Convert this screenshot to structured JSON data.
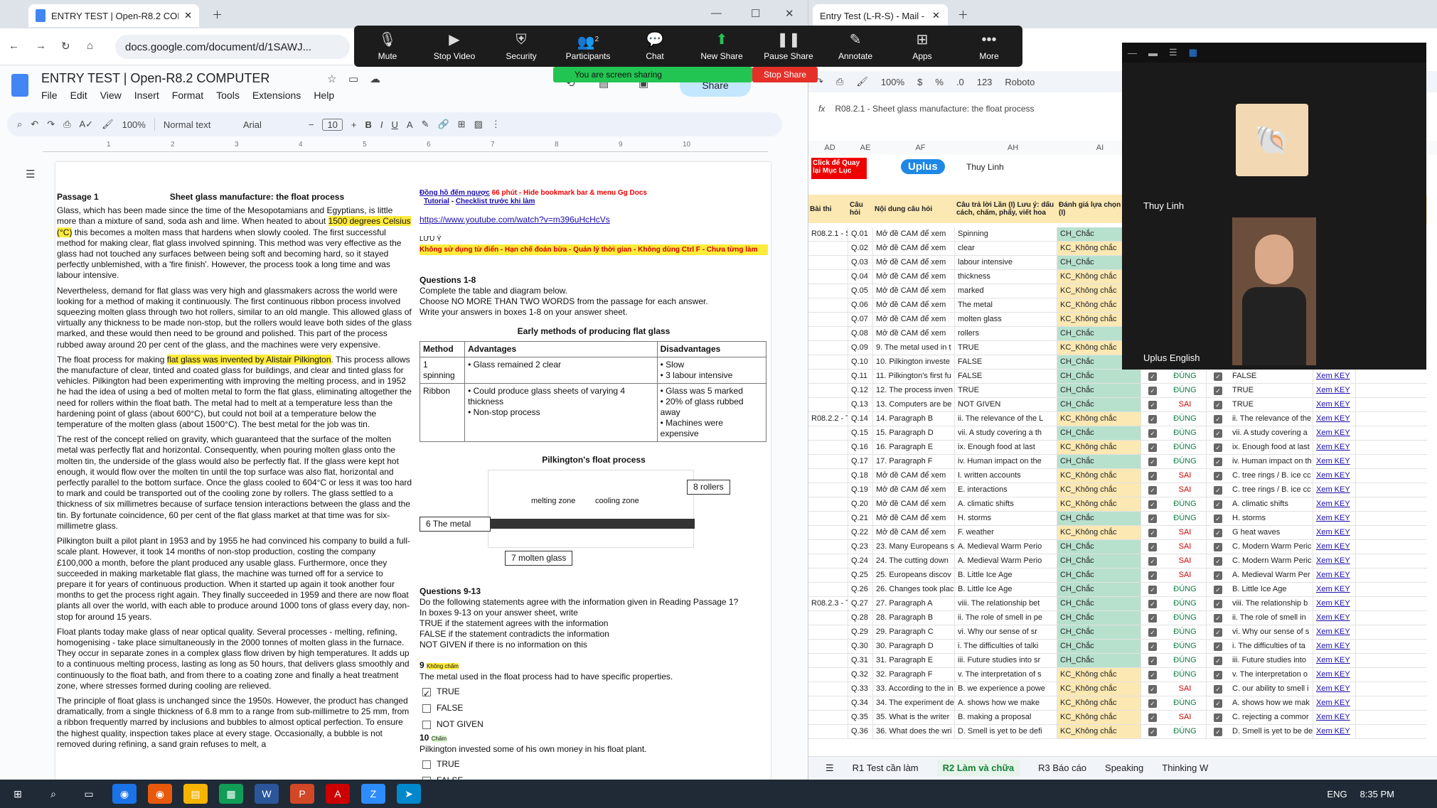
{
  "browser_left": {
    "tab_title": "ENTRY TEST | Open-R8.2 COMP",
    "url": "docs.google.com/document/d/1SAWJ..."
  },
  "browser_right": {
    "tab_title": "Entry Test (L-R-S) - Mail - P"
  },
  "zoom": {
    "buttons": [
      "Mute",
      "Stop Video",
      "Security",
      "Participants",
      "Chat",
      "New Share",
      "Pause Share",
      "Annotate",
      "Apps",
      "More"
    ],
    "participants_count": "2",
    "sharing_text": "You are screen sharing",
    "stop_share": "Stop Share",
    "participant1": "Thuy Linh",
    "participant2": "Uplus English"
  },
  "doc": {
    "title": "ENTRY TEST | Open-R8.2 COMPUTER",
    "menu": [
      "File",
      "Edit",
      "View",
      "Insert",
      "Format",
      "Tools",
      "Extensions",
      "Help"
    ],
    "share_label": "Share",
    "zoom": "100%",
    "style": "Normal text",
    "font": "Arial",
    "size": "10",
    "passage_label": "Passage 1",
    "passage_title": "Sheet glass manufacture: the float process",
    "p1a": "Glass, which has been made since the time of the Mesopotamians and Egyptians, is little more than a mixture of sand, soda ash and lime. When heated to about ",
    "p1hl": "1500 degrees Celsius (°C)",
    "p1b": " this becomes a molten mass that hardens when slowly cooled. The first successful method for making clear, flat glass involved spinning. This method was very effective as the glass had not touched any surfaces between being soft and becoming hard, so it stayed perfectly unblemished, with a 'fire finish'. However, the process took a long time and was labour intensive.",
    "p2": "Nevertheless, demand for flat glass was very high and glassmakers across the world were looking for a method of making it continuously. The first continuous ribbon process involved squeezing molten glass through two hot rollers, similar to an old mangle. This allowed glass of virtually any thickness to be made non-stop, but the rollers would leave both sides of the glass marked, and these would then need to be ground and polished. This part of the process rubbed away around 20 per cent of the glass, and the machines were very expensive.",
    "p3a": "The float process for making ",
    "p3hl": "flat glass was invented by Alistair Pilkington",
    "p3b": ". This process allows the manufacture of clear, tinted and coated glass for buildings, and clear and tinted glass for vehicles. Pilkington had been experimenting with improving the melting process, and in 1952 he had the idea of using a bed of molten metal to form the flat glass, eliminating altogether the need for rollers within the float bath. The metal had to melt at a temperature less than the hardening point of glass (about 600°C), but could not boil at a temperature below the temperature of the molten glass (about 1500°C). The best metal for the job was tin.",
    "p4": "The rest of the concept relied on gravity, which guaranteed that the surface of the molten metal was perfectly flat and horizontal. Consequently, when pouring molten glass onto the molten tin, the underside of the glass would also be perfectly flat. If the glass were kept hot enough, it would flow over the molten tin until the top surface was also flat, horizontal and perfectly parallel to the bottom surface. Once the glass cooled to 604°C or less it was too hard to mark and could be transported out of the cooling zone by rollers. The glass settled to a thickness of six millimetres because of surface tension interactions between the glass and the tin. By fortunate coincidence, 60 per cent of the flat glass market at that time was for six-millimetre glass.",
    "p5": "Pilkington built a pilot plant in 1953 and by 1955 he had convinced his company to build a full-scale plant. However, it took 14 months of non-stop production, costing the company £100,000 a month, before the plant produced any usable glass. Furthermore, once they succeeded in making marketable flat glass, the machine was turned off for a service to prepare it for years of continuous production. When it started up again it took another four months to get the process right again. They finally succeeded in 1959 and there are now float plants all over the world, with each able to produce around 1000 tons of glass every day, non-stop for around 15 years.",
    "p6": "Float plants today make glass of near optical quality. Several processes - melting, refining, homogenising - take place simultaneously in the 2000 tonnes of molten glass in the furnace. They occur in separate zones in a complex glass flow driven by high temperatures. It adds up to a continuous melting process, lasting as long as 50 hours, that delivers glass smoothly and continuously to the float bath, and from there to a coating zone and finally a heat treatment zone, where stresses formed during cooling are relieved.",
    "p7": "The principle of float glass is unchanged since the 1950s. However, the product has changed dramatically, from a single thickness of 6.8 mm to a range from sub-millimetre to 25 mm, from a ribbon frequently marred by inclusions and bubbles to almost optical perfection. To ensure the highest quality, inspection takes place at every stage. Occasionally, a bubble is not removed during refining, a sand grain refuses to melt, a",
    "r_timer": "Đồng hồ đếm ngược",
    "r_timer2": " 66 phút - Hide bookmark bar & menu Gg Docs",
    "r_tut": "Tutorial",
    "r_check": "Checklist trước khi làm",
    "r_link": "https://www.youtube.com/watch?v=m396uHcHcVs",
    "r_luuy": "LƯU Ý",
    "r_warn": "Không sử dụng từ điển - Hạn chế đoán bừa - Quản lý thời gian - Không dùng Ctrl F - Chưa từng làm",
    "q18": "Questions 1-8",
    "q18a": "Complete the table and diagram below.",
    "q18b": "Choose NO MORE THAN TWO WORDS from the passage for each answer.",
    "q18c": "Write your answers in boxes 1-8 on your answer sheet.",
    "tbl_title": "Early methods of producing flat glass",
    "th": [
      "Method",
      "Advantages",
      "Disadvantages"
    ],
    "r1": [
      "1  spinning",
      "• Glass remained 2  clear",
      "• Slow\n• 3  labour intensive"
    ],
    "r2": [
      "Ribbon",
      "• Could produce glass sheets of varying 4  thickness\n• Non-stop process",
      "• Glass was 5  marked\n• 20% of glass rubbed away\n• Machines were expensive"
    ],
    "diag_title": "Pilkington's float process",
    "melt": "melting zone",
    "cool": "cooling zone",
    "a8": "8  rollers",
    "a6": "6  The metal",
    "a7": "7  molten glass",
    "q913": "Questions 9-13",
    "q913a": "Do the following statements agree with the information given in Reading Passage 1?",
    "q913b": "In boxes 9-13 on your answer sheet, write",
    "tTrue": "TRUE   if the statement agrees with the information",
    "tFalse": "FALSE   if the statement contradicts the information",
    "tNG": "NOT GIVEN   if there is no information on this",
    "q9n": "9",
    "q9": "The metal used in the float process had to have specific properties.",
    "q10n": "10",
    "q10": "Pilkington invested some of his own money in his float plant.",
    "opt": [
      "TRUE",
      "FALSE",
      "NOT GIVEN"
    ],
    "tag_wrong": "Không chấm",
    "tag_ok": "Chấm"
  },
  "sheet": {
    "zoom": "100%",
    "font": "Roboto",
    "formula": "R08.2.1 - Sheet glass manufacture: the float process",
    "cols": [
      "AD",
      "AE",
      "AF",
      "AH",
      "AI"
    ],
    "link_text": "Click để Quay lại Mục Lục",
    "logo": "Uplus",
    "user": "Thuy Linh",
    "hdr": [
      "Bài thi",
      "Câu hỏi",
      "Nội dung câu hỏi",
      "Câu trả lời Lần (I) Lưu ý: dấu cách, chấm, phẩy, viết hoa",
      "Đánh giá lựa chọn Lần (I)"
    ],
    "rows": [
      [
        "R08.2.1 - S",
        "Q.01",
        "Mở đề CAM để xem",
        "Spinning",
        "CH_Chắc",
        "",
        "",
        "",
        "",
        ""
      ],
      [
        "",
        "Q.02",
        "Mở đề CAM để xem",
        "clear",
        "KC_Không chắc",
        "",
        "",
        "",
        "",
        ""
      ],
      [
        "",
        "Q.03",
        "Mở đề CAM để xem",
        "labour intensive",
        "CH_Chắc",
        "",
        "",
        "",
        "",
        ""
      ],
      [
        "",
        "Q.04",
        "Mở đề CAM để xem",
        "thickness",
        "KC_Không chắc",
        "",
        "",
        "",
        "",
        ""
      ],
      [
        "",
        "Q.05",
        "Mở đề CAM để xem",
        "marked",
        "KC_Không chắc",
        "",
        "",
        "",
        "",
        ""
      ],
      [
        "",
        "Q.06",
        "Mở đề CAM để xem",
        "The metal",
        "KC_Không chắc",
        "",
        "",
        "",
        "",
        ""
      ],
      [
        "",
        "Q.07",
        "Mở đề CAM để xem",
        "molten glass",
        "KC_Không chắc",
        "",
        "",
        "",
        "",
        ""
      ],
      [
        "",
        "Q.08",
        "Mở đề CAM để xem",
        "rollers",
        "CH_Chắc",
        "",
        "",
        "",
        "",
        ""
      ],
      [
        "",
        "Q.09",
        "9. The metal used in t",
        "TRUE",
        "KC_Không chắc",
        "",
        "",
        "",
        "",
        ""
      ],
      [
        "",
        "Q.10",
        "10. Pilkington investe",
        "FALSE",
        "CH_Chắc",
        "",
        "",
        "",
        "",
        ""
      ],
      [
        "",
        "Q.11",
        "11. Pilkington's first fu",
        "FALSE",
        "CH_Chắc",
        "✓",
        "ĐÚNG",
        "✓",
        "FALSE",
        "Xem KEY"
      ],
      [
        "",
        "Q.12",
        "12. The process inven",
        "TRUE",
        "CH_Chắc",
        "✓",
        "ĐÚNG",
        "✓",
        "TRUE",
        "Xem KEY"
      ],
      [
        "",
        "Q.13",
        "13. Computers are be",
        "NOT GIVEN",
        "CH_Chắc",
        "✓",
        "SAI",
        "✓",
        "TRUE",
        "Xem KEY"
      ],
      [
        "R08.2.2 - T",
        "Q.14",
        "14. Paragraph B",
        "ii. The relevance of the L",
        "KC_Không chắc",
        "✓",
        "ĐÚNG",
        "✓",
        "ii. The relevance of the",
        "Xem KEY"
      ],
      [
        "",
        "Q.15",
        "15. Paragraph D",
        "vii. A study covering a th",
        "CH_Chắc",
        "✓",
        "ĐÚNG",
        "✓",
        "vii. A study covering a",
        "Xem KEY"
      ],
      [
        "",
        "Q.16",
        "16. Paragraph E",
        "ix. Enough food at last",
        "KC_Không chắc",
        "✓",
        "ĐÚNG",
        "✓",
        "ix. Enough food at last",
        "Xem KEY"
      ],
      [
        "",
        "Q.17",
        "17. Paragraph F",
        "iv. Human impact on the",
        "CH_Chắc",
        "✓",
        "ĐÚNG",
        "✓",
        "iv. Human impact on th",
        "Xem KEY"
      ],
      [
        "",
        "Q.18",
        "Mở đề CAM để xem",
        "I. written accounts",
        "KC_Không chắc",
        "✓",
        "SAI",
        "✓",
        "C. tree rings / B. ice cc",
        "Xem KEY"
      ],
      [
        "",
        "Q.19",
        "Mở đề CAM để xem",
        "E. interactions",
        "KC_Không chắc",
        "✓",
        "SAI",
        "✓",
        "C. tree rings / B. ice cc",
        "Xem KEY"
      ],
      [
        "",
        "Q.20",
        "Mở đề CAM để xem",
        "A. climatic shifts",
        "KC_Không chắc",
        "✓",
        "ĐÚNG",
        "✓",
        "A. climatic shifts",
        "Xem KEY"
      ],
      [
        "",
        "Q.21",
        "Mở đề CAM để xem",
        "H. storms",
        "CH_Chắc",
        "✓",
        "ĐÚNG",
        "✓",
        "H. storms",
        "Xem KEY"
      ],
      [
        "",
        "Q.22",
        "Mở đề CAM để xem",
        "F. weather",
        "KC_Không chắc",
        "✓",
        "SAI",
        "✓",
        "G heat waves",
        "Xem KEY"
      ],
      [
        "",
        "Q.23",
        "23. Many Europeans s",
        "A. Medieval Warm Perio",
        "CH_Chắc",
        "✓",
        "SAI",
        "✓",
        "C. Modern Warm Peric",
        "Xem KEY"
      ],
      [
        "",
        "Q.24",
        "24. The cutting down",
        "A. Medieval Warm Perio",
        "CH_Chắc",
        "✓",
        "SAI",
        "✓",
        "C. Modern Warm Peric",
        "Xem KEY"
      ],
      [
        "",
        "Q.25",
        "25. Europeans discov",
        "B. Little Ice Age",
        "CH_Chắc",
        "✓",
        "SAI",
        "✓",
        "A. Medieval Warm Per",
        "Xem KEY"
      ],
      [
        "",
        "Q.26",
        "26. Changes took plac",
        "B. Little Ice Age",
        "CH_Chắc",
        "✓",
        "ĐÚNG",
        "✓",
        "B. Little Ice Age",
        "Xem KEY"
      ],
      [
        "R08.2.3 - T",
        "Q.27",
        "27. Paragraph A",
        "viii. The relationship bet",
        "CH_Chắc",
        "✓",
        "ĐÚNG",
        "✓",
        "viii. The relationship b",
        "Xem KEY"
      ],
      [
        "",
        "Q.28",
        "28. Paragraph B",
        "ii. The role of smell in pe",
        "CH_Chắc",
        "✓",
        "ĐÚNG",
        "✓",
        "ii. The role of smell in",
        "Xem KEY"
      ],
      [
        "",
        "Q.29",
        "29. Paragraph C",
        "vi. Why our sense of sr",
        "CH_Chắc",
        "✓",
        "ĐÚNG",
        "✓",
        "vi. Why our sense of s",
        "Xem KEY"
      ],
      [
        "",
        "Q.30",
        "30. Paragraph D",
        "i. The difficulties of talki",
        "CH_Chắc",
        "✓",
        "ĐÚNG",
        "✓",
        "i. The difficulties of ta",
        "Xem KEY"
      ],
      [
        "",
        "Q.31",
        "31. Paragraph E",
        "iii. Future studies into sr",
        "CH_Chắc",
        "✓",
        "ĐÚNG",
        "✓",
        "iii. Future studies into",
        "Xem KEY"
      ],
      [
        "",
        "Q.32",
        "32. Paragraph F",
        "v. The interpretation of s",
        "KC_Không chắc",
        "✓",
        "ĐÚNG",
        "✓",
        "v. The interpretation o",
        "Xem KEY"
      ],
      [
        "",
        "Q.33",
        "33. According to the in",
        "B. we experience a powe",
        "KC_Không chắc",
        "✓",
        "SAI",
        "✓",
        "C. our ability to smell i",
        "Xem KEY"
      ],
      [
        "",
        "Q.34",
        "34. The experiment de",
        "A. shows how we make",
        "KC_Không chắc",
        "✓",
        "ĐÚNG",
        "✓",
        "A. shows how we mak",
        "Xem KEY"
      ],
      [
        "",
        "Q.35",
        "35. What is the writer",
        "B. making a proposal",
        "KC_Không chắc",
        "✓",
        "SAI",
        "✓",
        "C. rejecting a commor",
        "Xem KEY"
      ],
      [
        "",
        "Q.36",
        "36. What does the wri",
        "D. Smell is yet to be defi",
        "KC_Không chắc",
        "✓",
        "ĐÚNG",
        "✓",
        "D. Smell is yet to be de",
        "Xem KEY"
      ]
    ],
    "tabs": [
      "R1 Test cần làm",
      "R2 Làm và chữa",
      "R3 Báo cáo",
      "Speaking",
      "Thinking W"
    ]
  },
  "taskbar": {
    "lang": "ENG",
    "time": "8:35 PM"
  }
}
